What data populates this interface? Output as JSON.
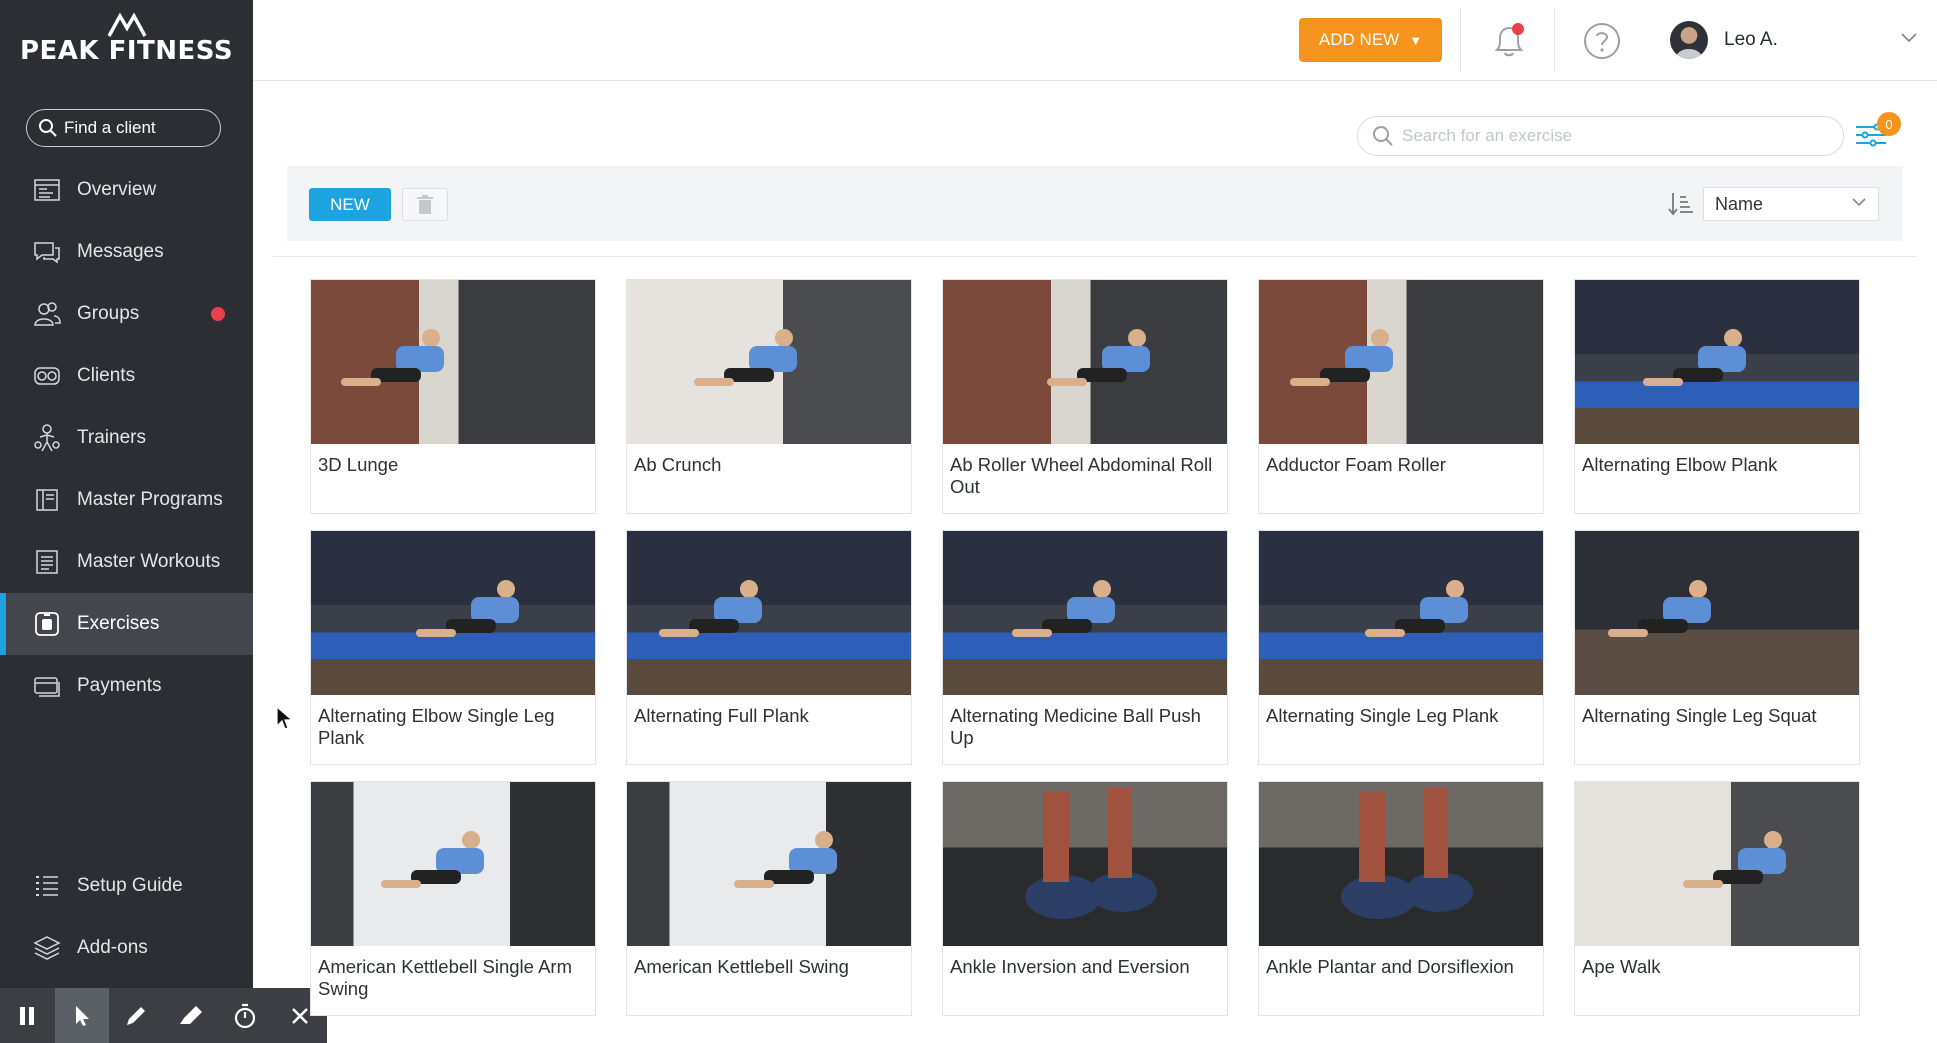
{
  "brand": {
    "name": "PEAK FITNESS",
    "logo_icon": "mountain-logo-icon"
  },
  "sidebar": {
    "find_client_label": "Find a client",
    "items": [
      {
        "id": "overview",
        "label": "Overview",
        "icon": "overview-icon"
      },
      {
        "id": "messages",
        "label": "Messages",
        "icon": "messages-icon"
      },
      {
        "id": "groups",
        "label": "Groups",
        "icon": "groups-icon",
        "badge_color": "#e8414b"
      },
      {
        "id": "clients",
        "label": "Clients",
        "icon": "clients-icon"
      },
      {
        "id": "trainers",
        "label": "Trainers",
        "icon": "trainers-icon"
      },
      {
        "id": "master-programs",
        "label": "Master Programs",
        "icon": "programs-icon"
      },
      {
        "id": "master-workouts",
        "label": "Master Workouts",
        "icon": "workouts-icon"
      },
      {
        "id": "exercises",
        "label": "Exercises",
        "icon": "exercises-icon",
        "active": true
      },
      {
        "id": "payments",
        "label": "Payments",
        "icon": "payments-icon"
      }
    ],
    "bottom_items": [
      {
        "id": "setup-guide",
        "label": "Setup Guide",
        "icon": "checklist-icon"
      },
      {
        "id": "add-ons",
        "label": "Add-ons",
        "icon": "layers-icon"
      }
    ]
  },
  "header": {
    "add_new_label": "ADD NEW",
    "notification_icon": "bell-icon",
    "help_icon": "help-icon",
    "user_name": "Leo A."
  },
  "search": {
    "placeholder": "Search for an exercise",
    "filter_count": "0"
  },
  "toolbar": {
    "new_label": "NEW",
    "sort_value": "Name"
  },
  "exercises": [
    {
      "title": "3D Lunge",
      "scene": "brick"
    },
    {
      "title": "Ab Crunch",
      "scene": "white"
    },
    {
      "title": "Ab Roller Wheel Abdominal Roll Out",
      "scene": "brick"
    },
    {
      "title": "Adductor Foam Roller",
      "scene": "brick"
    },
    {
      "title": "Alternating Elbow Plank",
      "scene": "blue"
    },
    {
      "title": "Alternating Elbow Single Leg Plank",
      "scene": "blue"
    },
    {
      "title": "Alternating Full Plank",
      "scene": "blue"
    },
    {
      "title": "Alternating Medicine Ball Push Up",
      "scene": "blue"
    },
    {
      "title": "Alternating Single Leg Plank",
      "scene": "blue"
    },
    {
      "title": "Alternating Single Leg Squat",
      "scene": "dark"
    },
    {
      "title": "American Kettlebell Single Arm Swing",
      "scene": "studio"
    },
    {
      "title": "American Kettlebell Swing",
      "scene": "studio"
    },
    {
      "title": "Ankle Inversion and Eversion",
      "scene": "feet"
    },
    {
      "title": "Ankle Plantar and Dorsiflexion",
      "scene": "feet"
    },
    {
      "title": "Ape Walk",
      "scene": "white"
    }
  ],
  "colors": {
    "accent": "#1ca3e0",
    "orange": "#f4941c",
    "sidebar": "#2b2e33"
  }
}
